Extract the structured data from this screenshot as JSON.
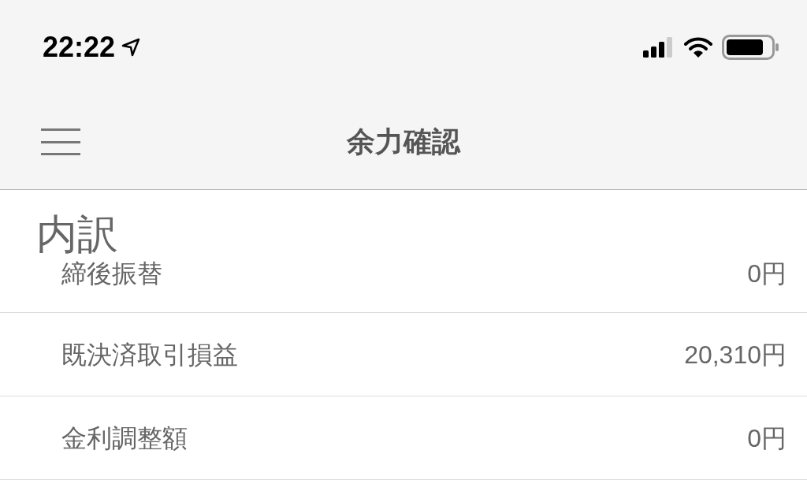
{
  "status_bar": {
    "time": "22:22"
  },
  "nav": {
    "title": "余力確認"
  },
  "section": {
    "title": "内訳"
  },
  "rows": [
    {
      "label": "締後振替",
      "value": "0円"
    },
    {
      "label": "既決済取引損益",
      "value": "20,310円"
    },
    {
      "label": "金利調整額",
      "value": "0円"
    }
  ]
}
